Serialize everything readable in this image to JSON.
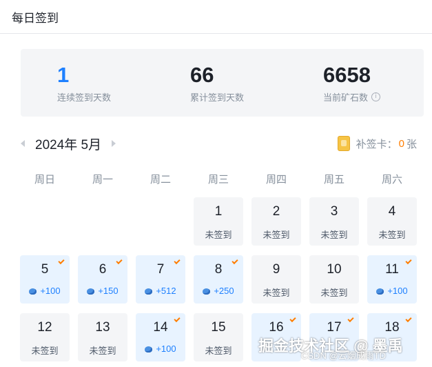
{
  "header": {
    "title": "每日签到"
  },
  "stats": [
    {
      "value": "1",
      "label": "连续签到天数"
    },
    {
      "value": "66",
      "label": "累计签到天数"
    },
    {
      "value": "6658",
      "label": "当前矿石数",
      "info_icon": "info-icon"
    }
  ],
  "calendar": {
    "month_label": "2024年 5月",
    "makeup_card": {
      "label": "补签卡：",
      "count": "0",
      "unit": "张"
    },
    "weekdays": [
      "周日",
      "周一",
      "周二",
      "周三",
      "周四",
      "周五",
      "周六"
    ],
    "first_weekday_index": 3,
    "days": [
      {
        "day": "1",
        "signed": false,
        "text": "未签到"
      },
      {
        "day": "2",
        "signed": false,
        "text": "未签到"
      },
      {
        "day": "3",
        "signed": false,
        "text": "未签到"
      },
      {
        "day": "4",
        "signed": false,
        "text": "未签到"
      },
      {
        "day": "5",
        "signed": true,
        "text": "+100"
      },
      {
        "day": "6",
        "signed": true,
        "text": "+150"
      },
      {
        "day": "7",
        "signed": true,
        "text": "+512"
      },
      {
        "day": "8",
        "signed": true,
        "text": "+250"
      },
      {
        "day": "9",
        "signed": false,
        "text": "未签到"
      },
      {
        "day": "10",
        "signed": false,
        "text": "未签到"
      },
      {
        "day": "11",
        "signed": true,
        "text": "+100"
      },
      {
        "day": "12",
        "signed": false,
        "text": "未签到"
      },
      {
        "day": "13",
        "signed": false,
        "text": "未签到"
      },
      {
        "day": "14",
        "signed": true,
        "text": "+100"
      },
      {
        "day": "15",
        "signed": false,
        "text": "未签到"
      },
      {
        "day": "16",
        "signed": true,
        "text": ""
      },
      {
        "day": "17",
        "signed": true,
        "text": ""
      },
      {
        "day": "18",
        "signed": true,
        "text": ""
      }
    ]
  },
  "watermark": {
    "main": "掘金技术社区 @ 墨禹",
    "sub": "CSDN @云烟成雨TD"
  },
  "colors": {
    "accent": "#1e80ff",
    "check": "#ff7d00",
    "signed_bg": "#e8f3ff",
    "unsigned_bg": "#f4f5f7"
  }
}
